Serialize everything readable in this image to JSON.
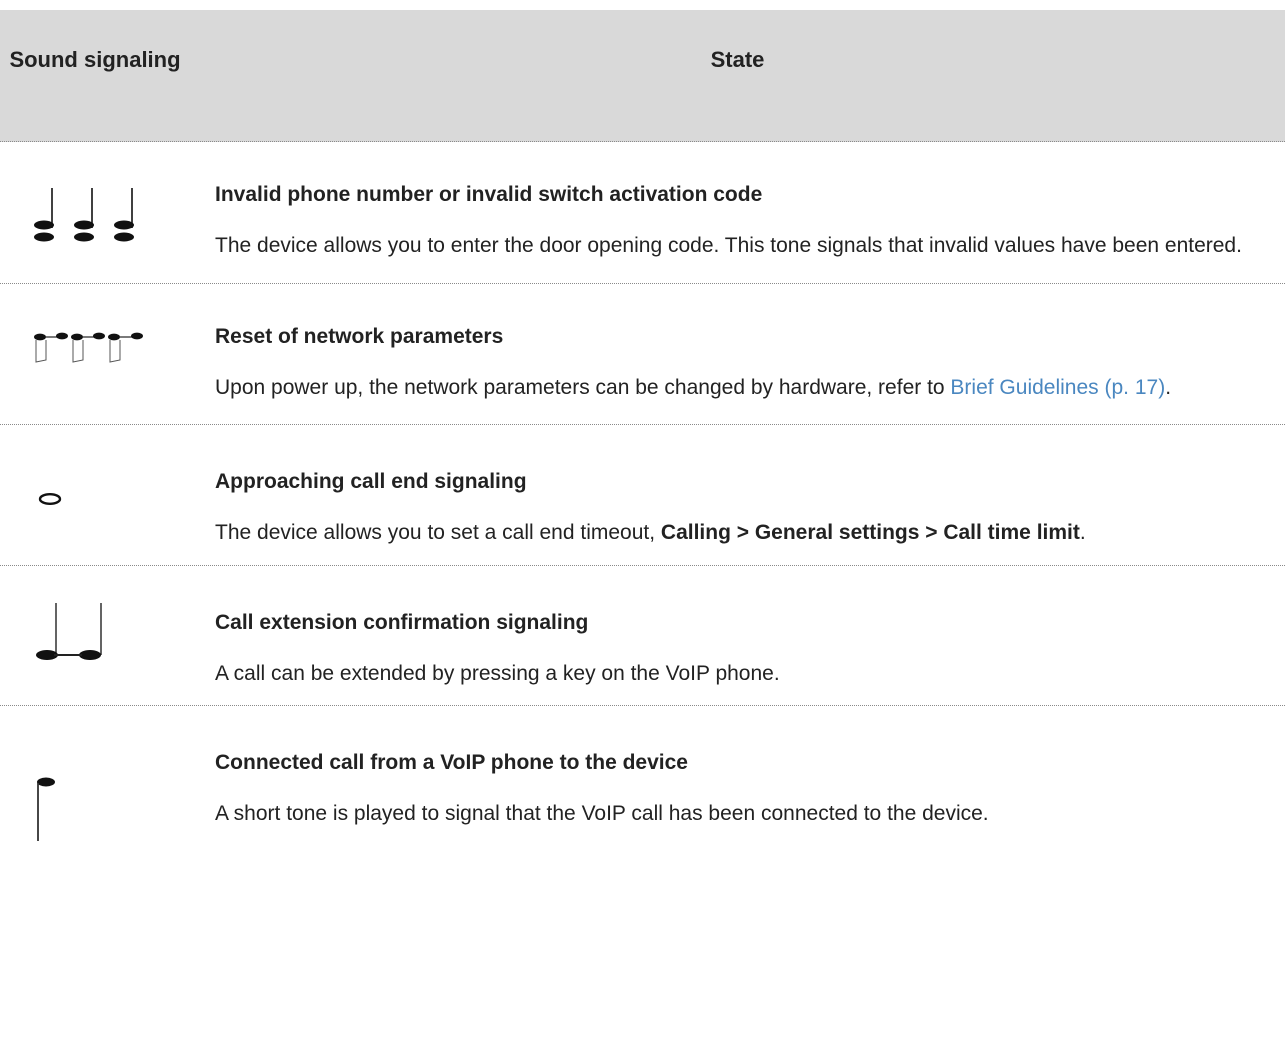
{
  "header": {
    "col_sound": "Sound signaling",
    "col_state": "State"
  },
  "rows": [
    {
      "icon": "three-eighth-notes-icon",
      "title": "Invalid phone number or invalid switch activation code",
      "desc": "The device allows you to enter the door opening code. This tone signals that invalid values have been entered."
    },
    {
      "icon": "three-hollow-eighth-notes-icon",
      "title": "Reset of network parameters",
      "desc_prefix": "Upon power up, the network parameters can be changed by hardware, refer to ",
      "desc_link": "Brief Guidelines (p. 17)",
      "desc_suffix": "."
    },
    {
      "icon": "whole-note-icon",
      "title": "Approaching call end signaling",
      "desc_prefix": "The device allows you to set a call end timeout, ",
      "desc_bold": "Calling > General settings > Call time limit",
      "desc_suffix": "."
    },
    {
      "icon": "two-notes-icon",
      "title": "Call extension confirmation signaling",
      "desc": "A call can be extended by pressing a key on the VoIP phone."
    },
    {
      "icon": "single-flag-note-icon",
      "title": "Connected call from a VoIP phone to the device",
      "desc": "A short tone is played to signal that the VoIP call has been connected to the device."
    }
  ]
}
